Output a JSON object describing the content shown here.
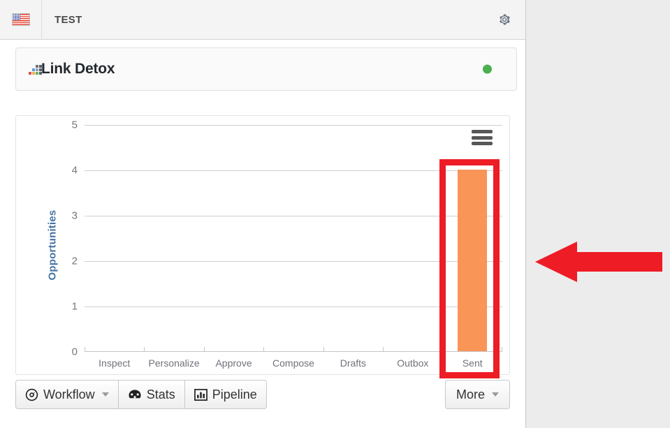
{
  "header": {
    "flag_icon": "us-flag-icon",
    "title": "TEST",
    "settings_icon": "gear-icon"
  },
  "brand": {
    "logo_icon": "link-detox-logo-icon",
    "name": "Link Detox",
    "status_icon": "status-dot-green",
    "status_color": "#4caf50"
  },
  "chart": {
    "menu_icon": "hamburger-menu-icon"
  },
  "chart_data": {
    "type": "bar",
    "title": "",
    "xlabel": "",
    "ylabel": "Opportunities",
    "categories": [
      "Inspect",
      "Personalize",
      "Approve",
      "Compose",
      "Drafts",
      "Outbox",
      "Sent"
    ],
    "values": [
      0,
      0,
      0,
      0,
      0,
      0,
      4
    ],
    "ylim": [
      0,
      5
    ],
    "yticks": [
      "0",
      "1",
      "2",
      "3",
      "4",
      "5"
    ],
    "grid": true,
    "legend": "none",
    "bar_color": "#f99557",
    "axis_label_color": "#4473a3",
    "tick_color": "#777777"
  },
  "annotations": {
    "highlight_box": {
      "name": "sent-column-highlight",
      "color": "#ee1c25",
      "target": "Sent"
    },
    "arrow": {
      "name": "red-left-arrow",
      "color": "#ee1c25",
      "direction": "left"
    }
  },
  "toolbar": {
    "buttons": [
      {
        "label": "Workflow",
        "icon": "compass-icon",
        "caret": true
      },
      {
        "label": "Stats",
        "icon": "dashboard-icon",
        "caret": false
      },
      {
        "label": "Pipeline",
        "icon": "bar-chart-icon",
        "caret": false
      }
    ],
    "more": {
      "label": "More",
      "caret": true
    }
  }
}
